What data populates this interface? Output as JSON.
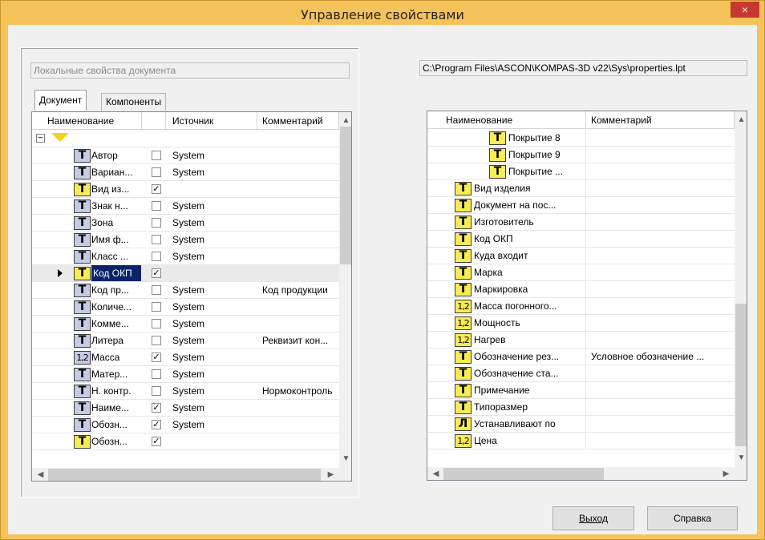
{
  "window": {
    "title": "Управление свойствами",
    "close_glyph": "×"
  },
  "left": {
    "caption": "Локальные свойства документа",
    "tabs": [
      "Документ",
      "Компоненты"
    ],
    "columns": [
      "Наименование",
      "",
      "Источник",
      "Комментарий"
    ],
    "rows": [
      {
        "icon": "T",
        "color": "blue",
        "name": "Автор",
        "checked": false,
        "source": "System",
        "comment": ""
      },
      {
        "icon": "T",
        "color": "blue",
        "name": "Вариан...",
        "checked": false,
        "source": "System",
        "comment": ""
      },
      {
        "icon": "T",
        "color": "yellow",
        "name": "Вид из...",
        "checked": true,
        "source": "",
        "comment": ""
      },
      {
        "icon": "T",
        "color": "blue",
        "name": "Знак н...",
        "checked": false,
        "source": "System",
        "comment": ""
      },
      {
        "icon": "T",
        "color": "blue",
        "name": "Зона",
        "checked": false,
        "source": "System",
        "comment": ""
      },
      {
        "icon": "T",
        "color": "blue",
        "name": "Имя ф...",
        "checked": false,
        "source": "System",
        "comment": ""
      },
      {
        "icon": "T",
        "color": "blue",
        "name": "Класс ...",
        "checked": false,
        "source": "System",
        "comment": ""
      },
      {
        "icon": "T",
        "color": "yellow",
        "name": "Код ОКП",
        "checked": true,
        "source": "",
        "comment": "",
        "selected": true
      },
      {
        "icon": "T",
        "color": "blue",
        "name": "Код пр...",
        "checked": false,
        "source": "System",
        "comment": "Код продукции"
      },
      {
        "icon": "T",
        "color": "blue",
        "name": "Количе...",
        "checked": false,
        "source": "System",
        "comment": ""
      },
      {
        "icon": "T",
        "color": "blue",
        "name": "Комме...",
        "checked": false,
        "source": "System",
        "comment": ""
      },
      {
        "icon": "T",
        "color": "blue",
        "name": "Литера",
        "checked": false,
        "source": "System",
        "comment": "Реквизит кон..."
      },
      {
        "icon": "1,2",
        "color": "blue",
        "name": "Масса",
        "checked": true,
        "source": "System",
        "comment": ""
      },
      {
        "icon": "T",
        "color": "blue",
        "name": "Матер...",
        "checked": false,
        "source": "System",
        "comment": ""
      },
      {
        "icon": "T",
        "color": "blue",
        "name": "Н. контр.",
        "checked": false,
        "source": "System",
        "comment": "Нормоконтроль"
      },
      {
        "icon": "T",
        "color": "blue",
        "name": "Наиме...",
        "checked": true,
        "source": "System",
        "comment": ""
      },
      {
        "icon": "T",
        "color": "blue",
        "name": "Обозн...",
        "checked": true,
        "source": "System",
        "comment": ""
      },
      {
        "icon": "T",
        "color": "yellow",
        "name": "Обозн...",
        "checked": true,
        "source": "",
        "comment": ""
      }
    ]
  },
  "right": {
    "path": "C:\\Program Files\\ASCON\\KOMPAS-3D v22\\Sys\\properties.lpt",
    "columns": [
      "Наименование",
      "Комментарий"
    ],
    "rows": [
      {
        "icon": "T",
        "indent": 2,
        "name": "Покрытие 8",
        "comment": ""
      },
      {
        "icon": "T",
        "indent": 2,
        "name": "Покрытие 9",
        "comment": ""
      },
      {
        "icon": "T",
        "indent": 2,
        "name": "Покрытие ...",
        "comment": ""
      },
      {
        "icon": "T",
        "indent": 1,
        "name": "Вид изделия",
        "comment": ""
      },
      {
        "icon": "T",
        "indent": 1,
        "name": "Документ на пос...",
        "comment": ""
      },
      {
        "icon": "T",
        "indent": 1,
        "name": "Изготовитель",
        "comment": ""
      },
      {
        "icon": "T",
        "indent": 1,
        "name": "Код ОКП",
        "comment": ""
      },
      {
        "icon": "T",
        "indent": 1,
        "name": "Куда входит",
        "comment": ""
      },
      {
        "icon": "T",
        "indent": 1,
        "name": "Марка",
        "comment": ""
      },
      {
        "icon": "T",
        "indent": 1,
        "name": "Маркировка",
        "comment": ""
      },
      {
        "icon": "1,2",
        "indent": 1,
        "name": "Масса погонного...",
        "comment": ""
      },
      {
        "icon": "1,2",
        "indent": 1,
        "name": "Мощность",
        "comment": ""
      },
      {
        "icon": "1,2",
        "indent": 1,
        "name": "Нагрев",
        "comment": ""
      },
      {
        "icon": "T",
        "indent": 1,
        "name": "Обозначение рез...",
        "comment": "Условное обозначение ..."
      },
      {
        "icon": "T",
        "indent": 1,
        "name": "Обозначение ста...",
        "comment": ""
      },
      {
        "icon": "T",
        "indent": 1,
        "name": "Примечание",
        "comment": ""
      },
      {
        "icon": "T",
        "indent": 1,
        "name": "Типоразмер",
        "comment": ""
      },
      {
        "icon": "Л",
        "indent": 1,
        "name": "Устанавливают по",
        "comment": ""
      },
      {
        "icon": "1,2",
        "indent": 1,
        "name": "Цена",
        "comment": ""
      }
    ]
  },
  "buttons": {
    "exit": "Выход",
    "help": "Справка"
  }
}
